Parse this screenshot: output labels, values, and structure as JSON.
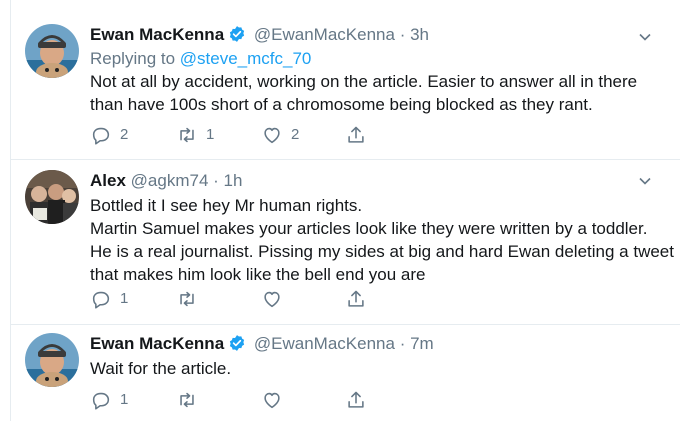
{
  "colors": {
    "accent": "#1da1f2",
    "text": "#14171a",
    "muted": "#657786",
    "divider": "#e6ecf0"
  },
  "tweets": [
    {
      "name": "Ewan MacKenna",
      "verified": true,
      "handle": "@EwanMacKenna",
      "time": "· 3h",
      "replying_prefix": "Replying to ",
      "replying_handle": "@steve_mcfc_70",
      "lines": [
        "Not at all by accident, working on the article. Easier to answer all in there",
        "than have 100s short of a chromosome being blocked as they rant."
      ],
      "reply_count": "2",
      "retweet_count": "1",
      "like_count": "2"
    },
    {
      "name": "Alex",
      "verified": false,
      "handle": "@agkm74",
      "time": "· 1h",
      "lines": [
        "Bottled it I see hey Mr human rights.",
        "Martin Samuel makes your articles look like they were written by a toddler.",
        "He is a real journalist. Pissing my sides at big and hard Ewan deleting a tweet",
        "that makes him look like the bell end you are"
      ],
      "reply_count": "1",
      "retweet_count": "",
      "like_count": ""
    },
    {
      "name": "Ewan MacKenna",
      "verified": true,
      "handle": "@EwanMacKenna",
      "time": "· 7m",
      "lines": [
        "Wait for the article."
      ],
      "reply_count": "1",
      "retweet_count": "",
      "like_count": ""
    }
  ],
  "icons": {
    "reply": "reply-icon",
    "retweet": "retweet-icon",
    "like": "heart-icon",
    "share": "share-icon",
    "more": "chevron-down-icon",
    "verified": "verified-badge-icon"
  }
}
